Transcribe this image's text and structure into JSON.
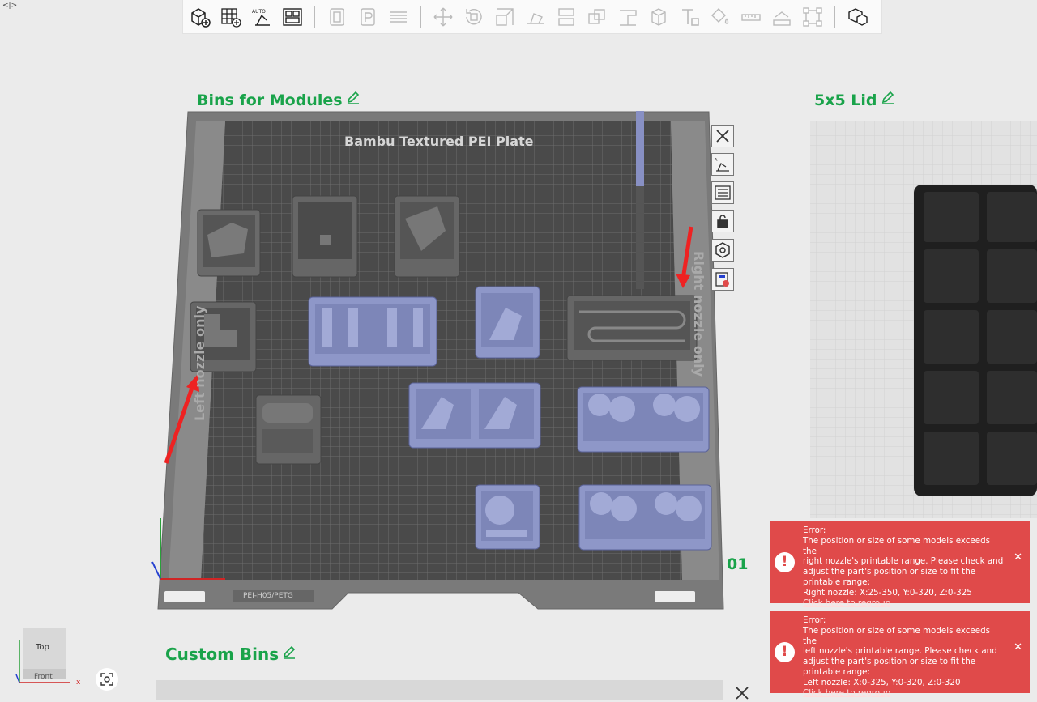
{
  "corner_toggle": "<|>",
  "toolbar": {
    "icons": [
      "add-part-icon",
      "add-plate-icon",
      "auto-orient-icon",
      "arrange-icon",
      "split-objects-icon",
      "split-parts-icon",
      "layers-icon",
      "move-icon",
      "rotate-icon",
      "scale-icon",
      "lay-on-face-icon",
      "cut-icon",
      "boolean-icon",
      "support-paint-icon",
      "seam-paint-icon",
      "text-icon",
      "color-paint-icon",
      "measure-icon",
      "assembly-icon",
      "fit-bed-icon",
      "assembly-view-icon"
    ]
  },
  "plates": {
    "plate1": {
      "title": "Bins for Modules",
      "bed_label": "Bambu Textured PEI Plate",
      "bed_sub_label": "PEI-H05/PETG",
      "left_side_label": "Left nozzle only",
      "right_side_label": "Right nozzle only",
      "plate_number": "01"
    },
    "plate2": {
      "title": "5x5 Lid"
    },
    "plate3": {
      "title": "Custom Bins"
    }
  },
  "side_icons": [
    "close-icon",
    "orient-plate-icon",
    "arrange-plate-icon",
    "lock-icon",
    "settings-icon",
    "plate-settings-icon"
  ],
  "errors": [
    {
      "heading": "Error:",
      "lines": [
        "The position or size of some models exceeds the",
        "right nozzle's printable range. Please check and",
        "adjust the part's position or size to fit the",
        "printable range:",
        "Right nozzle: X:25-350, Y:0-320, Z:0-325"
      ],
      "link": "Click here to regroup"
    },
    {
      "heading": "Error:",
      "lines": [
        "The position or size of some models exceeds the",
        "left nozzle's printable range. Please check and",
        "adjust the part's position or size to fit the",
        "printable range:",
        "Left nozzle: X:0-325, Y:0-320, Z:0-320"
      ],
      "link": "Click here to regroup"
    }
  ],
  "navcube": {
    "top": "Top",
    "front": "Front",
    "x_axis": "x"
  },
  "colors": {
    "accent_green": "#19a34a",
    "error_red": "#e04a4a",
    "model_blue": "#8e97c8",
    "model_gray": "#5a5a5a",
    "arrow_red": "#ee2222"
  }
}
